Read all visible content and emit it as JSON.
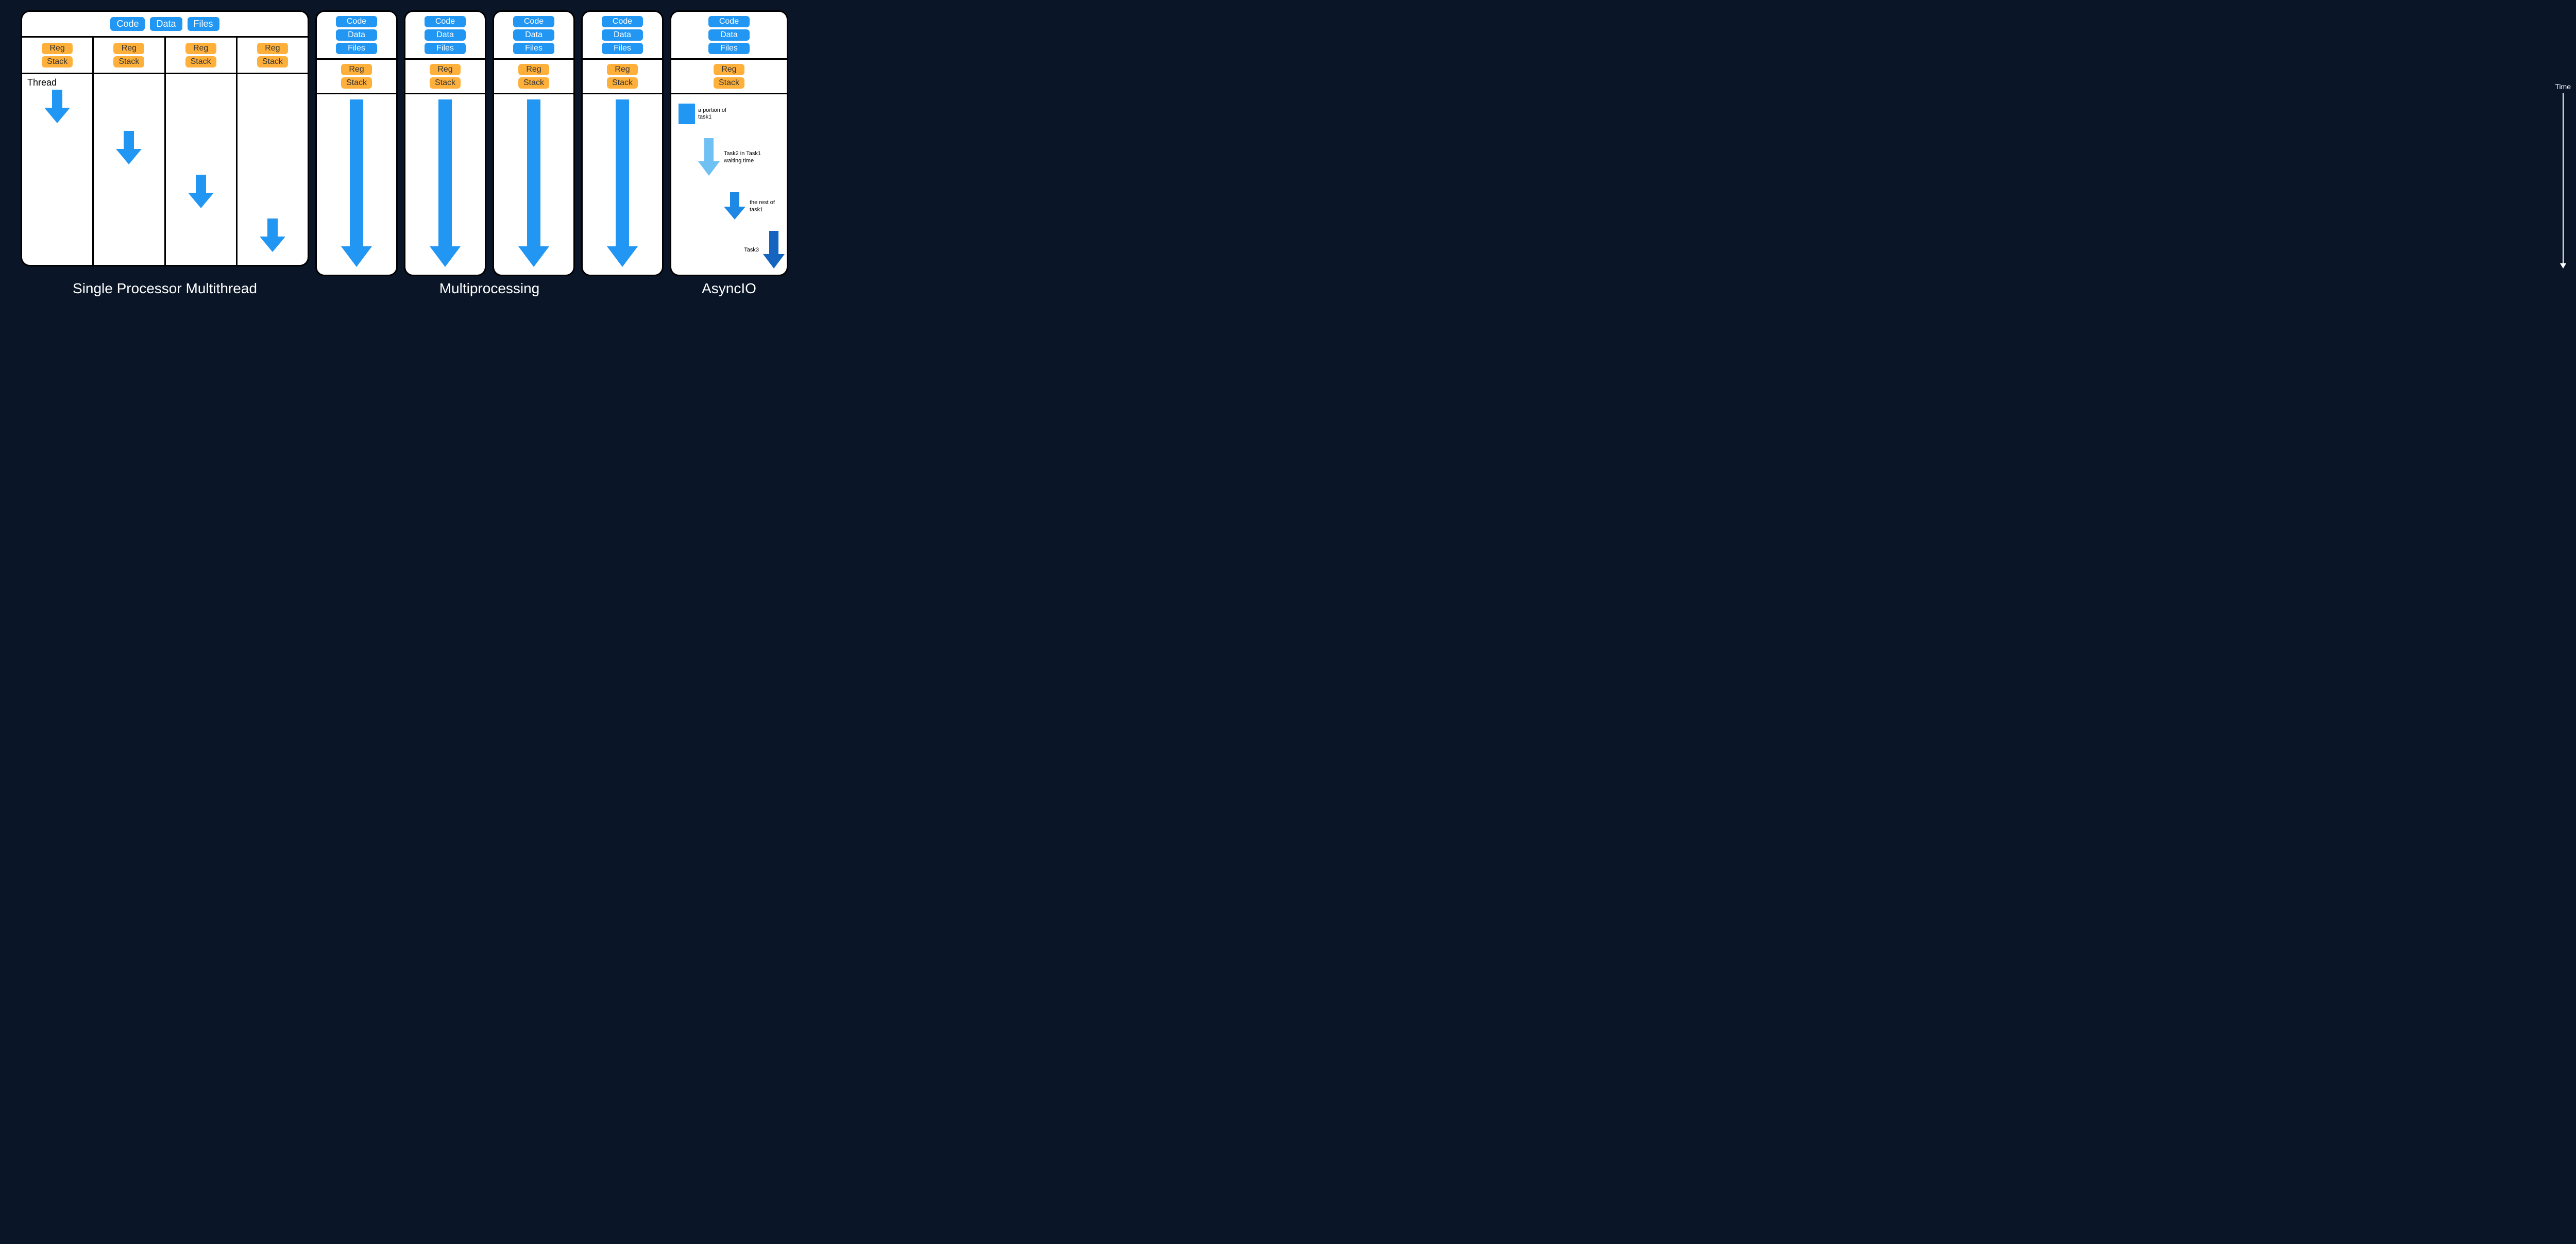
{
  "tags": {
    "code": "Code",
    "data": "Data",
    "files": "Files",
    "reg": "Reg",
    "stack": "Stack"
  },
  "multithread": {
    "thread_label": "Thread",
    "caption": "Single Processor Multithread",
    "threads": 4
  },
  "multiprocessing": {
    "caption": "Multiprocessing",
    "processes": 4
  },
  "asyncio": {
    "caption": "AsyncIO",
    "items": [
      {
        "label": "a portion of task1",
        "shape": "block",
        "color": "#2196f3"
      },
      {
        "label": "Task2 in Task1 waiting time",
        "shape": "arrow",
        "color": "#6fc0f3"
      },
      {
        "label": "the rest of task1",
        "shape": "arrow",
        "color": "#1e88e5"
      },
      {
        "label": "Task3",
        "shape": "arrow",
        "color": "#1565c0"
      }
    ]
  },
  "time_label": "Time",
  "colors": {
    "blue": "#2196f3",
    "orange": "#ffb03b",
    "bg": "#0a1628"
  }
}
